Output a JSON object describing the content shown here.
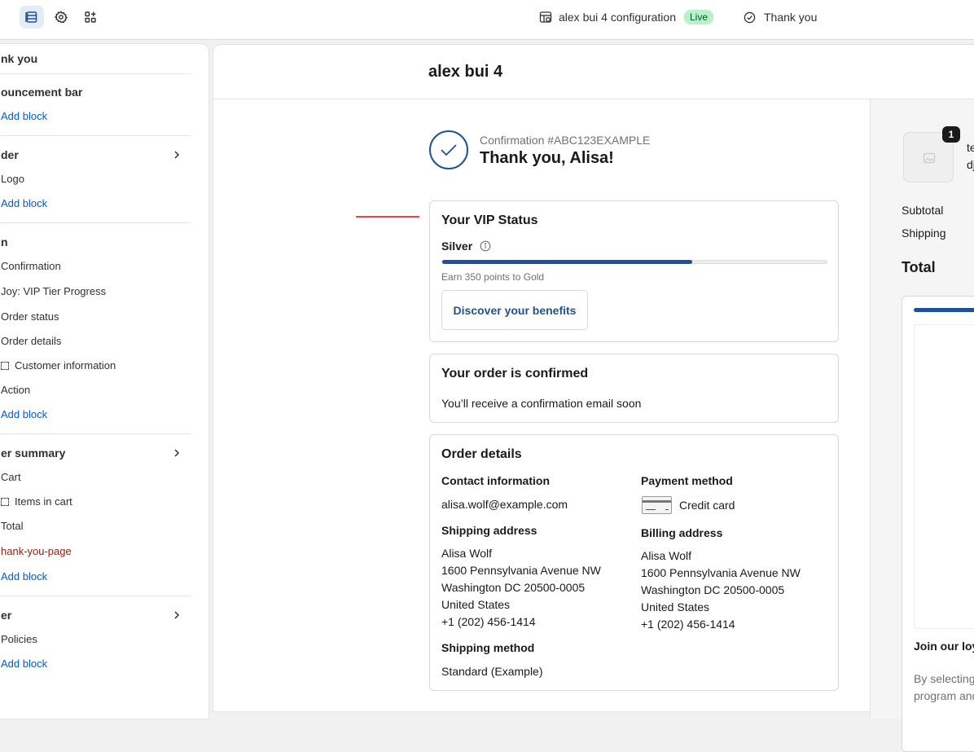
{
  "topbar": {
    "config_name": "alex bui 4 configuration",
    "live_badge": "Live",
    "page_name": "Thank you"
  },
  "sidebar": {
    "title": "nk you",
    "sections": {
      "announcement": {
        "heading": "ouncement bar",
        "add": "Add block"
      },
      "header": {
        "heading": "der",
        "items": [
          "Logo"
        ],
        "add": "Add block"
      },
      "main": {
        "heading": "n",
        "items": [
          "Confirmation",
          "Joy: VIP Tier Progress",
          "Order status",
          "Order details",
          "Customer information",
          "Action"
        ],
        "add": "Add block"
      },
      "summary": {
        "heading": "er summary",
        "items": [
          "Cart",
          "Items in cart",
          "Total",
          "hank-you-page"
        ],
        "add": "Add block"
      },
      "footer": {
        "heading": "er",
        "items": [
          "Policies"
        ],
        "add": "Add block"
      }
    }
  },
  "shop": {
    "name": "alex bui 4"
  },
  "confirmation": {
    "number": "Confirmation #ABC123EXAMPLE",
    "thanks": "Thank you, Alisa!"
  },
  "vip": {
    "title": "Your VIP Status",
    "tier": "Silver",
    "progress": 0.65,
    "points_text": "Earn 350 points to Gold",
    "button": "Discover your benefits"
  },
  "order_confirmed": {
    "title": "Your order is confirmed",
    "text": "You’ll receive a confirmation email soon"
  },
  "order_details": {
    "title": "Order details",
    "contact_label": "Contact information",
    "contact_value": "alisa.wolf@example.com",
    "payment_label": "Payment method",
    "payment_value": "Credit card",
    "shipping_label": "Shipping address",
    "shipping_lines": [
      "Alisa Wolf",
      "1600 Pennsylvania Avenue NW",
      "Washington DC 20500-0005",
      "United States",
      "+1 (202) 456-1414"
    ],
    "billing_label": "Billing address",
    "billing_lines": [
      "Alisa Wolf",
      "1600 Pennsylvania Avenue NW",
      "Washington DC 20500-0005",
      "United States",
      "+1 (202) 456-1414"
    ],
    "method_label": "Shipping method",
    "method_value": "Standard (Example)"
  },
  "summary": {
    "qty": "1",
    "item_line1": "te",
    "item_line2": "dj",
    "subtotal": "Subtotal",
    "shipping": "Shipping",
    "total": "Total",
    "loyalty_title": "Join our loy",
    "loyalty_text1": "By selecting",
    "loyalty_text2": "program and"
  },
  "colors": {
    "accent": "#1f5199",
    "link": "#005bd3",
    "live_bg": "#b5f2c7"
  }
}
